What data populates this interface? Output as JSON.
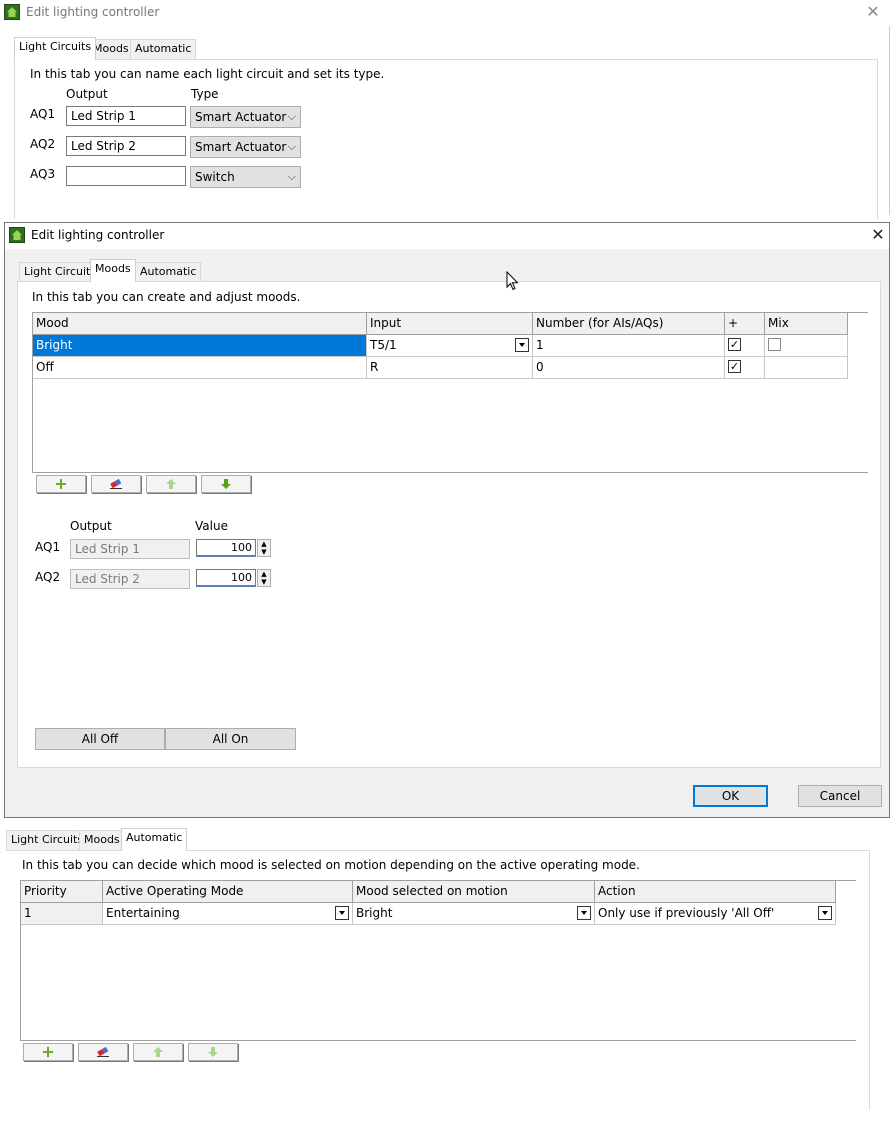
{
  "dialog1": {
    "title": "Edit lighting controller",
    "tabs": [
      "Light Circuits",
      "Moods",
      "Automatic"
    ],
    "intro": "In this tab you can name each light circuit and set its type.",
    "col_output": "Output",
    "col_type": "Type",
    "rows": [
      {
        "label": "AQ1",
        "output": "Led Strip 1",
        "type": "Smart Actuator"
      },
      {
        "label": "AQ2",
        "output": "Led Strip 2",
        "type": "Smart Actuator"
      },
      {
        "label": "AQ3",
        "output": "",
        "type": "Switch"
      }
    ]
  },
  "dialog2": {
    "title": "Edit lighting controller",
    "tabs": [
      "Light Circuits",
      "Moods",
      "Automatic"
    ],
    "intro": "In this tab you can create and adjust moods.",
    "grid_headers": [
      "Mood",
      "Input",
      "Number (for AIs/AQs)",
      "+",
      "Mix"
    ],
    "grid_rows": [
      {
        "mood": "Bright",
        "input": "T5/1",
        "number": "1",
        "plus": true,
        "mix": false,
        "selected": true
      },
      {
        "mood": "Off",
        "input": "R",
        "number": "0",
        "plus": true,
        "mix": null,
        "selected": false
      }
    ],
    "col_output": "Output",
    "col_value": "Value",
    "outputs": [
      {
        "label": "AQ1",
        "name": "Led Strip 1",
        "value": "100"
      },
      {
        "label": "AQ2",
        "name": "Led Strip 2",
        "value": "100"
      }
    ],
    "all_off": "All Off",
    "all_on": "All On",
    "ok": "OK",
    "cancel": "Cancel"
  },
  "dialog3": {
    "tabs": [
      "Light Circuits",
      "Moods",
      "Automatic"
    ],
    "intro": "In this tab you can decide which mood is selected on motion depending on the active operating mode.",
    "grid_headers": [
      "Priority",
      "Active Operating Mode",
      "Mood selected on motion",
      "Action"
    ],
    "grid_rows": [
      {
        "priority": "1",
        "mode": "Entertaining",
        "mood": "Bright",
        "action": "Only use if previously 'All Off'"
      }
    ]
  },
  "icons": {
    "app": "house-icon",
    "add": "plus-icon",
    "delete": "eraser-icon",
    "up": "arrow-up-icon",
    "down": "arrow-down-icon",
    "close": "close-icon",
    "cursor": "mouse-pointer-icon"
  },
  "colors": {
    "selection": "#0078d7",
    "accent_green": "#6fa829",
    "default_button_border": "#0078d7"
  }
}
